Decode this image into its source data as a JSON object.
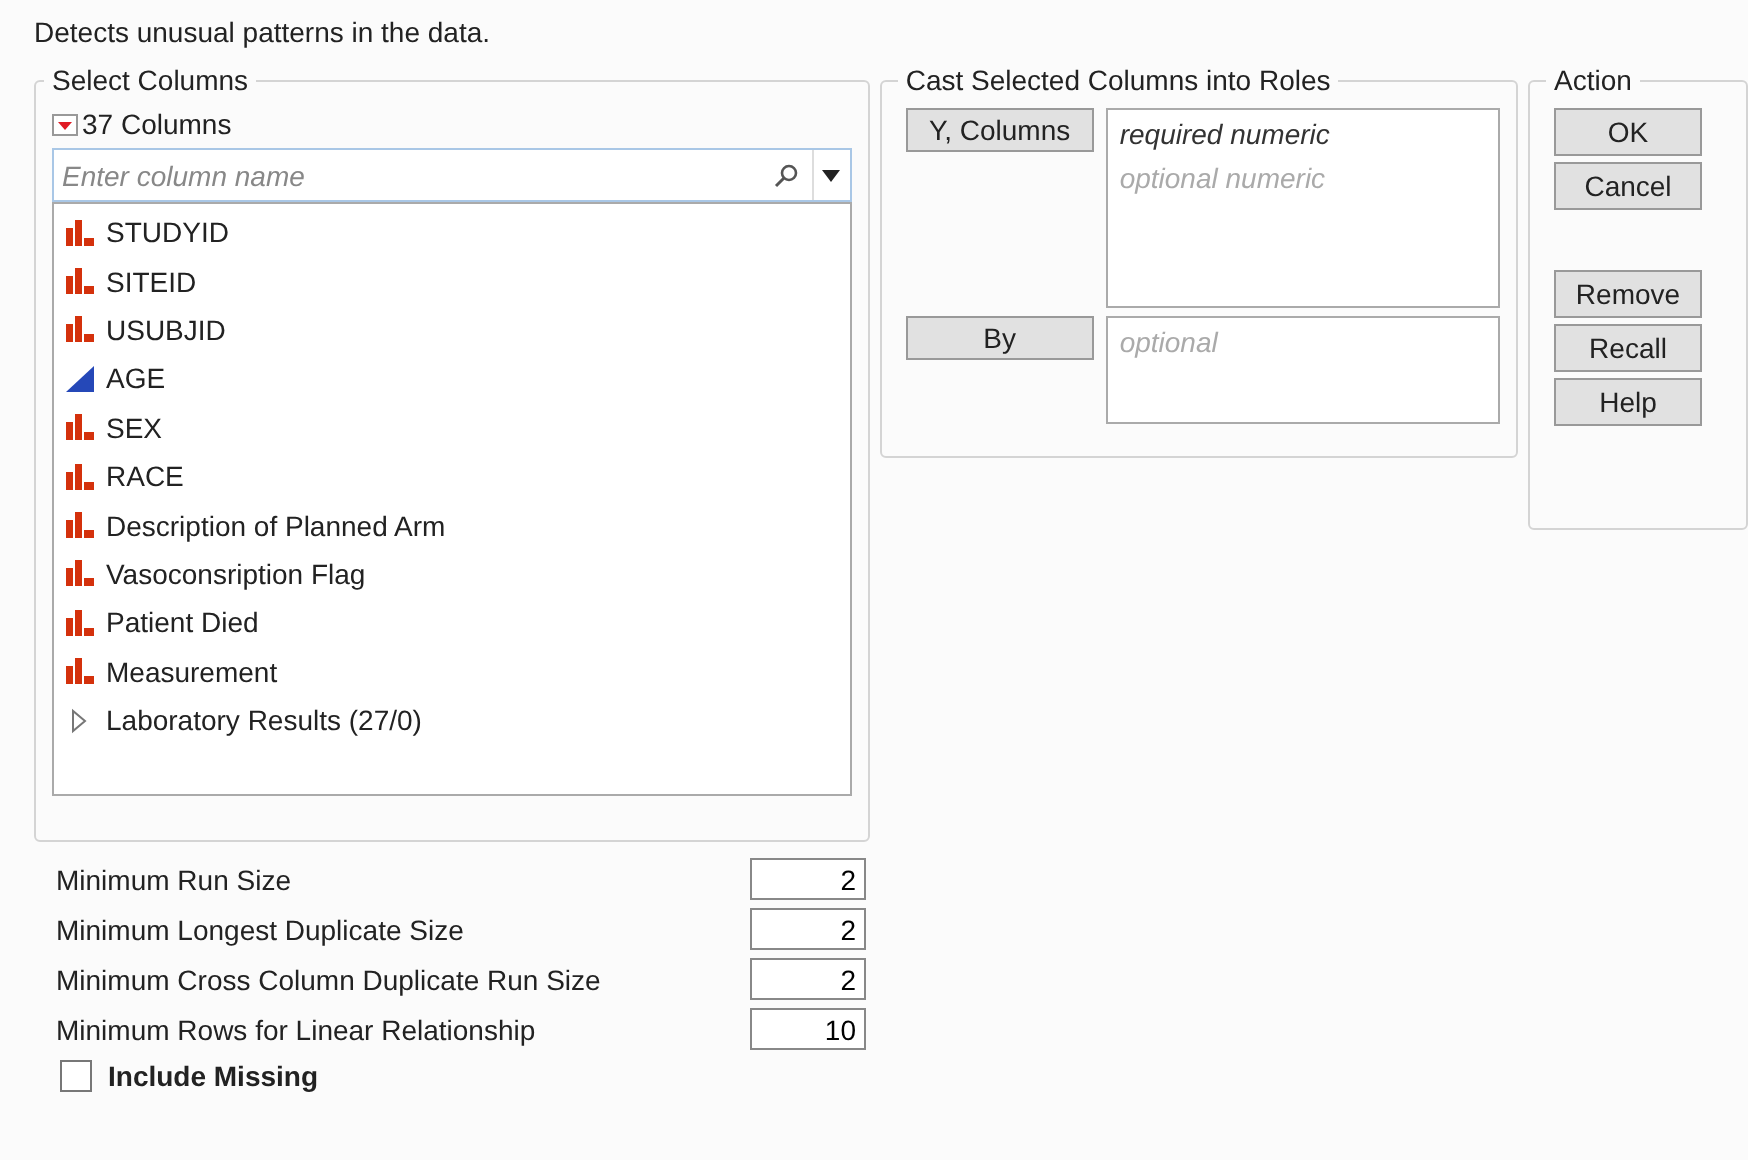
{
  "description": "Detects unusual patterns in the data.",
  "select_columns": {
    "title": "Select Columns",
    "count": "37 Columns",
    "search": {
      "placeholder": "Enter column name"
    },
    "items": [
      {
        "label": "STUDYID",
        "kind": "nominal"
      },
      {
        "label": "SITEID",
        "kind": "nominal"
      },
      {
        "label": "USUBJID",
        "kind": "nominal"
      },
      {
        "label": "AGE",
        "kind": "continuous"
      },
      {
        "label": "SEX",
        "kind": "nominal"
      },
      {
        "label": "RACE",
        "kind": "nominal"
      },
      {
        "label": "Description of Planned Arm",
        "kind": "nominal"
      },
      {
        "label": "Vasoconsription Flag",
        "kind": "nominal"
      },
      {
        "label": "Patient Died",
        "kind": "nominal"
      },
      {
        "label": "Measurement",
        "kind": "nominal"
      },
      {
        "label": "Laboratory Results (27/0)",
        "kind": "group",
        "expanded": false
      }
    ]
  },
  "roles": {
    "title": "Cast Selected Columns into Roles",
    "rows": [
      {
        "button": "Y, Columns",
        "hints": [
          {
            "text": "required numeric",
            "required": true
          },
          {
            "text": "optional numeric",
            "required": false
          }
        ]
      },
      {
        "button": "By",
        "hints": [
          {
            "text": "optional",
            "required": false
          }
        ]
      }
    ]
  },
  "action": {
    "title": "Action",
    "buttons": [
      [
        "OK",
        "Cancel"
      ],
      [
        "Remove",
        "Recall",
        "Help"
      ]
    ]
  },
  "options": [
    {
      "label": "Minimum Run Size",
      "value": "2"
    },
    {
      "label": "Minimum Longest Duplicate Size",
      "value": "2"
    },
    {
      "label": "Minimum Cross Column Duplicate Run Size",
      "value": "2"
    },
    {
      "label": "Minimum Rows for Linear Relationship",
      "value": "10"
    }
  ],
  "include_missing": {
    "label": "Include Missing",
    "checked": false
  }
}
